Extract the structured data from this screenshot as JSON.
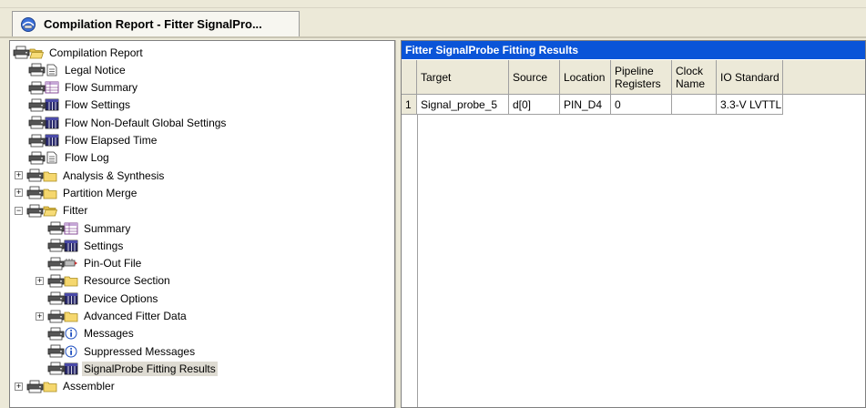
{
  "tab": {
    "title": "Compilation Report - Fitter SignalPro...",
    "icon": "report-tab-icon"
  },
  "tree": {
    "items": [
      {
        "label": "Compilation Report",
        "icon": "folder-open-icon",
        "expander": ""
      },
      {
        "label": "Legal Notice",
        "icon": "document-icon",
        "expander": ""
      },
      {
        "label": "Flow Summary",
        "icon": "summary-table-icon",
        "expander": ""
      },
      {
        "label": "Flow Settings",
        "icon": "table-icon",
        "expander": ""
      },
      {
        "label": "Flow Non-Default Global Settings",
        "icon": "table-icon",
        "expander": ""
      },
      {
        "label": "Flow Elapsed Time",
        "icon": "table-icon",
        "expander": ""
      },
      {
        "label": "Flow Log",
        "icon": "document-icon",
        "expander": ""
      },
      {
        "label": "Analysis & Synthesis",
        "icon": "folder-icon",
        "expander": "+"
      },
      {
        "label": "Partition Merge",
        "icon": "folder-icon",
        "expander": "+"
      },
      {
        "label": "Fitter",
        "icon": "folder-open-icon",
        "expander": "−"
      },
      {
        "label": "Summary",
        "icon": "summary-table-icon",
        "expander": ""
      },
      {
        "label": "Settings",
        "icon": "table-icon",
        "expander": ""
      },
      {
        "label": "Pin-Out File",
        "icon": "pinout-file-icon",
        "expander": ""
      },
      {
        "label": "Resource Section",
        "icon": "folder-icon",
        "expander": "+"
      },
      {
        "label": "Device Options",
        "icon": "table-icon",
        "expander": ""
      },
      {
        "label": "Advanced Fitter Data",
        "icon": "folder-icon",
        "expander": "+"
      },
      {
        "label": "Messages",
        "icon": "info-icon",
        "expander": ""
      },
      {
        "label": "Suppressed Messages",
        "icon": "info-icon",
        "expander": ""
      },
      {
        "label": "SignalProbe Fitting Results",
        "icon": "table-icon",
        "expander": "",
        "selected": true
      },
      {
        "label": "Assembler",
        "icon": "folder-icon",
        "expander": "+"
      }
    ]
  },
  "results": {
    "title": "Fitter SignalProbe Fitting Results",
    "columns": [
      "Target",
      "Source",
      "Location",
      "Pipeline Registers",
      "Clock Name",
      "IO Standard"
    ],
    "rows": [
      {
        "num": "1",
        "cells": [
          "Signal_probe_5",
          "d[0]",
          "PIN_D4",
          "0",
          "",
          "3.3-V LVTTL"
        ]
      }
    ]
  },
  "colors": {
    "title_bar": "#0a54d8",
    "header_bg": "#ece9d8",
    "selection": "#dedbd2"
  }
}
